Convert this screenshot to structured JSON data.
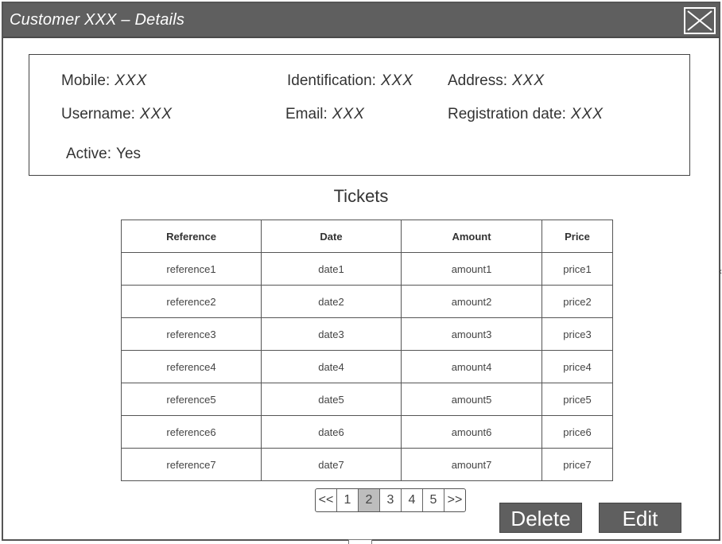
{
  "window": {
    "title": "Customer XXX – Details",
    "close_icon": "close-x-icon"
  },
  "customer": {
    "mobile": {
      "label": "Mobile:",
      "value": "XXX"
    },
    "identification": {
      "label": "Identification:",
      "value": "XXX"
    },
    "address": {
      "label": "Address:",
      "value": "XXX"
    },
    "username": {
      "label": "Username:",
      "value": "XXX"
    },
    "email": {
      "label": "Email:",
      "value": "XXX"
    },
    "registration_date": {
      "label": "Registration date:",
      "value": "XXX"
    },
    "active": {
      "label": "Active:",
      "value": "Yes"
    }
  },
  "tickets": {
    "title": "Tickets",
    "columns": [
      "Reference",
      "Date",
      "Amount",
      "Price"
    ],
    "rows": [
      [
        "reference1",
        "date1",
        "amount1",
        "price1"
      ],
      [
        "reference2",
        "date2",
        "amount2",
        "price2"
      ],
      [
        "reference3",
        "date3",
        "amount3",
        "price3"
      ],
      [
        "reference4",
        "date4",
        "amount4",
        "price4"
      ],
      [
        "reference5",
        "date5",
        "amount5",
        "price5"
      ],
      [
        "reference6",
        "date6",
        "amount6",
        "price6"
      ],
      [
        "reference7",
        "date7",
        "amount7",
        "price7"
      ]
    ]
  },
  "pagination": {
    "first": "<<",
    "pages": [
      "1",
      "2",
      "3",
      "4",
      "5"
    ],
    "current": "2",
    "last": ">>"
  },
  "actions": {
    "delete_label": "Delete",
    "edit_label": "Edit"
  },
  "colors": {
    "titlebar": "#5f5f5f",
    "active_page": "#bdbdbd",
    "button": "#5f5f5f"
  }
}
